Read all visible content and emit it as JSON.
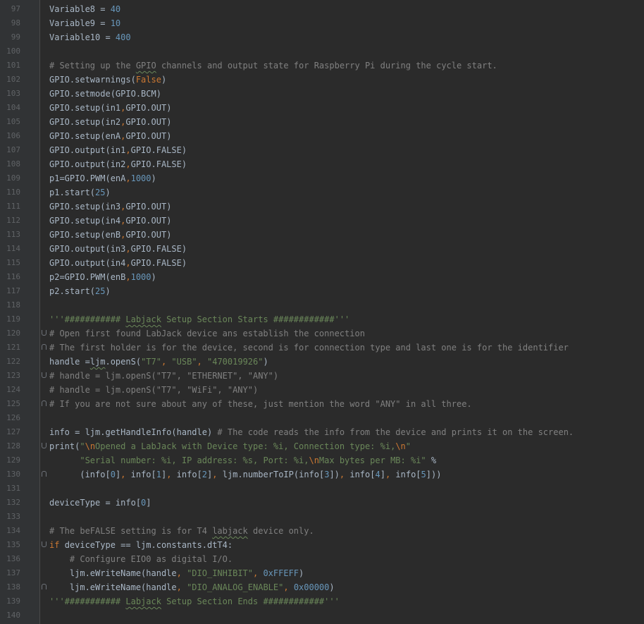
{
  "editor": {
    "colors": {
      "background": "#2b2b2b",
      "gutter": "#313335",
      "line_number": "#606366",
      "comment": "#808080",
      "string": "#6a8759",
      "number": "#6897bb",
      "keyword": "#cc7832",
      "plain": "#a9b7c6"
    },
    "lines": [
      {
        "n": "97",
        "t": [
          [
            "p",
            "Variable8 = "
          ],
          [
            "n",
            "40"
          ]
        ]
      },
      {
        "n": "98",
        "t": [
          [
            "p",
            "Variable9 = "
          ],
          [
            "n",
            "10"
          ]
        ]
      },
      {
        "n": "99",
        "t": [
          [
            "p",
            "Variable10 = "
          ],
          [
            "n",
            "400"
          ]
        ]
      },
      {
        "n": "100",
        "t": []
      },
      {
        "n": "101",
        "t": [
          [
            "c",
            "# Setting up the "
          ],
          [
            "cu",
            "GPIO"
          ],
          [
            "c",
            " channels and output state for Raspberry Pi during the cycle start."
          ]
        ]
      },
      {
        "n": "102",
        "t": [
          [
            "p",
            "GPIO.setwarnings("
          ],
          [
            "k",
            "False"
          ],
          [
            "p",
            ")"
          ]
        ]
      },
      {
        "n": "103",
        "t": [
          [
            "p",
            "GPIO.setmode(GPIO.BCM)"
          ]
        ]
      },
      {
        "n": "104",
        "t": [
          [
            "p",
            "GPIO.setup(in1"
          ],
          [
            "k",
            ","
          ],
          [
            "p",
            "GPIO.OUT)"
          ]
        ]
      },
      {
        "n": "105",
        "t": [
          [
            "p",
            "GPIO.setup(in2"
          ],
          [
            "k",
            ","
          ],
          [
            "p",
            "GPIO.OUT)"
          ]
        ]
      },
      {
        "n": "106",
        "t": [
          [
            "p",
            "GPIO.setup(enA"
          ],
          [
            "k",
            ","
          ],
          [
            "p",
            "GPIO.OUT)"
          ]
        ]
      },
      {
        "n": "107",
        "t": [
          [
            "p",
            "GPIO.output(in1"
          ],
          [
            "k",
            ","
          ],
          [
            "p",
            "GPIO.FALSE)"
          ]
        ]
      },
      {
        "n": "108",
        "t": [
          [
            "p",
            "GPIO.output(in2"
          ],
          [
            "k",
            ","
          ],
          [
            "p",
            "GPIO.FALSE)"
          ]
        ]
      },
      {
        "n": "109",
        "t": [
          [
            "p",
            "p1=GPIO.PWM(enA"
          ],
          [
            "k",
            ","
          ],
          [
            "n",
            "1000"
          ],
          [
            "p",
            ")"
          ]
        ]
      },
      {
        "n": "110",
        "t": [
          [
            "p",
            "p1.start("
          ],
          [
            "n",
            "25"
          ],
          [
            "p",
            ")"
          ]
        ]
      },
      {
        "n": "111",
        "t": [
          [
            "p",
            "GPIO.setup(in3"
          ],
          [
            "k",
            ","
          ],
          [
            "p",
            "GPIO.OUT)"
          ]
        ]
      },
      {
        "n": "112",
        "t": [
          [
            "p",
            "GPIO.setup(in4"
          ],
          [
            "k",
            ","
          ],
          [
            "p",
            "GPIO.OUT)"
          ]
        ]
      },
      {
        "n": "113",
        "t": [
          [
            "p",
            "GPIO.setup(enB"
          ],
          [
            "k",
            ","
          ],
          [
            "p",
            "GPIO.OUT)"
          ]
        ]
      },
      {
        "n": "114",
        "t": [
          [
            "p",
            "GPIO.output(in3"
          ],
          [
            "k",
            ","
          ],
          [
            "p",
            "GPIO.FALSE)"
          ]
        ]
      },
      {
        "n": "115",
        "t": [
          [
            "p",
            "GPIO.output(in4"
          ],
          [
            "k",
            ","
          ],
          [
            "p",
            "GPIO.FALSE)"
          ]
        ]
      },
      {
        "n": "116",
        "t": [
          [
            "p",
            "p2=GPIO.PWM(enB"
          ],
          [
            "k",
            ","
          ],
          [
            "n",
            "1000"
          ],
          [
            "p",
            ")"
          ]
        ]
      },
      {
        "n": "117",
        "t": [
          [
            "p",
            "p2.start("
          ],
          [
            "n",
            "25"
          ],
          [
            "p",
            ")"
          ]
        ]
      },
      {
        "n": "118",
        "t": []
      },
      {
        "n": "119",
        "t": [
          [
            "s",
            "'''########### "
          ],
          [
            "su",
            "Labjack"
          ],
          [
            "s",
            " Setup Section Starts ############'''"
          ]
        ]
      },
      {
        "n": "120",
        "fold": "down",
        "t": [
          [
            "c",
            "# Open first found LabJack device ans establish the connection"
          ]
        ]
      },
      {
        "n": "121",
        "fold": "up",
        "t": [
          [
            "c",
            "# The first holder is for the device, second is for connection type and last one is for the identifier"
          ]
        ]
      },
      {
        "n": "122",
        "t": [
          [
            "p",
            "handle ="
          ],
          [
            "pu",
            "ljm"
          ],
          [
            "p",
            ".openS("
          ],
          [
            "s",
            "\"T7\""
          ],
          [
            "k",
            ", "
          ],
          [
            "s",
            "\"USB\""
          ],
          [
            "k",
            ", "
          ],
          [
            "s",
            "\"470019926\""
          ],
          [
            "p",
            ")"
          ]
        ]
      },
      {
        "n": "123",
        "fold": "down",
        "t": [
          [
            "c",
            "# handle = ljm.openS(\"T7\", \"ETHERNET\", \"ANY\")"
          ]
        ]
      },
      {
        "n": "124",
        "t": [
          [
            "c",
            "# handle = ljm.openS(\"T7\", \"WiFi\", \"ANY\")"
          ]
        ]
      },
      {
        "n": "125",
        "fold": "up",
        "t": [
          [
            "c",
            "# If you are not sure about any of these, just mention the word \"ANY\" in all three."
          ]
        ]
      },
      {
        "n": "126",
        "t": []
      },
      {
        "n": "127",
        "t": [
          [
            "p",
            "info = ljm.getHandleInfo(handle)"
          ],
          [
            "p",
            " "
          ],
          [
            "c",
            "# The code reads the info from the device and prints it on the screen."
          ]
        ]
      },
      {
        "n": "128",
        "fold": "down",
        "t": [
          [
            "p",
            "print("
          ],
          [
            "s",
            "\""
          ],
          [
            "e",
            "\\n"
          ],
          [
            "s",
            "Opened a LabJack with Device type: %i, Connection type: %i,"
          ],
          [
            "e",
            "\\n"
          ],
          [
            "s",
            "\""
          ]
        ]
      },
      {
        "n": "129",
        "t": [
          [
            "p",
            "      "
          ],
          [
            "s",
            "\"Serial number: %i, IP address: %s, Port: %i,"
          ],
          [
            "e",
            "\\n"
          ],
          [
            "s",
            "Max bytes per MB: %i\""
          ],
          [
            "p",
            " %"
          ]
        ]
      },
      {
        "n": "130",
        "fold": "up",
        "t": [
          [
            "p",
            "      (info["
          ],
          [
            "n",
            "0"
          ],
          [
            "p",
            "]"
          ],
          [
            "k",
            ", "
          ],
          [
            "p",
            "info["
          ],
          [
            "n",
            "1"
          ],
          [
            "p",
            "]"
          ],
          [
            "k",
            ", "
          ],
          [
            "p",
            "info["
          ],
          [
            "n",
            "2"
          ],
          [
            "p",
            "]"
          ],
          [
            "k",
            ", "
          ],
          [
            "p",
            "ljm.numberToIP(info["
          ],
          [
            "n",
            "3"
          ],
          [
            "p",
            "])"
          ],
          [
            "k",
            ", "
          ],
          [
            "p",
            "info["
          ],
          [
            "n",
            "4"
          ],
          [
            "p",
            "]"
          ],
          [
            "k",
            ", "
          ],
          [
            "p",
            "info["
          ],
          [
            "n",
            "5"
          ],
          [
            "p",
            "]))"
          ]
        ]
      },
      {
        "n": "131",
        "t": []
      },
      {
        "n": "132",
        "t": [
          [
            "p",
            "deviceType = info["
          ],
          [
            "n",
            "0"
          ],
          [
            "p",
            "]"
          ]
        ]
      },
      {
        "n": "133",
        "t": []
      },
      {
        "n": "134",
        "t": [
          [
            "c",
            "# The beFALSE setting is for T4 "
          ],
          [
            "cu",
            "labjack"
          ],
          [
            "c",
            " device only."
          ]
        ]
      },
      {
        "n": "135",
        "fold": "down",
        "t": [
          [
            "k",
            "if "
          ],
          [
            "p",
            "deviceType == ljm.constants.dtT4:"
          ]
        ]
      },
      {
        "n": "136",
        "t": [
          [
            "p",
            "    "
          ],
          [
            "c",
            "# Configure EIO0 as digital I/O."
          ]
        ]
      },
      {
        "n": "137",
        "t": [
          [
            "p",
            "    ljm.eWriteName(handle"
          ],
          [
            "k",
            ", "
          ],
          [
            "s",
            "\"DIO_INHIBIT\""
          ],
          [
            "k",
            ", "
          ],
          [
            "n",
            "0xFFEFF"
          ],
          [
            "p",
            ")"
          ]
        ]
      },
      {
        "n": "138",
        "fold": "up",
        "t": [
          [
            "p",
            "    ljm.eWriteName(handle"
          ],
          [
            "k",
            ", "
          ],
          [
            "s",
            "\"DIO_ANALOG_ENABLE\""
          ],
          [
            "k",
            ", "
          ],
          [
            "n",
            "0x00000"
          ],
          [
            "p",
            ")"
          ]
        ]
      },
      {
        "n": "139",
        "t": [
          [
            "s",
            "'''########### "
          ],
          [
            "su",
            "Labjack"
          ],
          [
            "s",
            " Setup Section Ends ############'''"
          ]
        ]
      },
      {
        "n": "140",
        "t": []
      }
    ]
  }
}
